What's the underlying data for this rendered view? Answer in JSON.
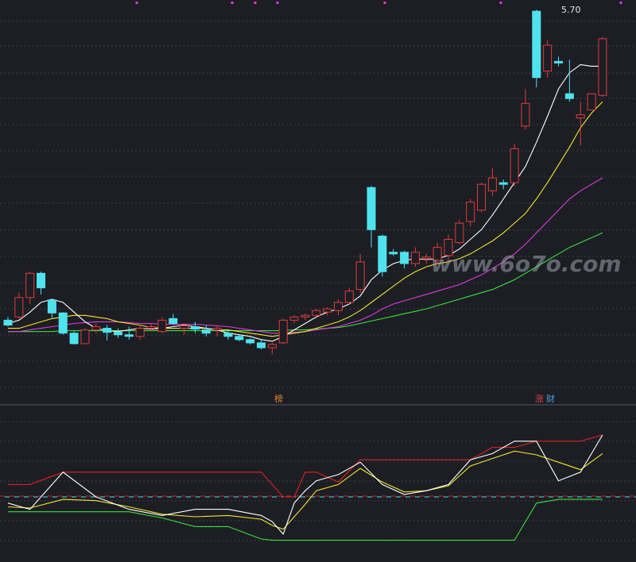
{
  "chart_data": {
    "type": "candlestick",
    "peak_label": "5.70",
    "watermark": "www.6o7o.com",
    "tags": [
      {
        "text": "榜",
        "color": "#e08a2e"
      },
      {
        "text": "涨",
        "color": "#e04040"
      },
      {
        "text": "财",
        "color": "#4aa0e0"
      }
    ],
    "colors": {
      "up": "#e03b3b",
      "down": "#4fe3ee",
      "ma5": "#ffffff",
      "ma10": "#f2e62a",
      "ma20": "#e03be0",
      "ma60": "#3be03b",
      "ind_red": "#e02020",
      "ind_white": "#ffffff",
      "ind_yellow": "#f2e62a",
      "ind_green": "#3be03b"
    },
    "price_range": [
      1.05,
      5.8
    ],
    "candles": [
      [
        1.9,
        1.94,
        1.82,
        1.84
      ],
      [
        1.94,
        2.24,
        1.92,
        2.18
      ],
      [
        2.18,
        2.5,
        2.1,
        2.48
      ],
      [
        2.48,
        2.5,
        2.22,
        2.3
      ],
      [
        2.15,
        2.16,
        1.93,
        1.99
      ],
      [
        1.99,
        2.0,
        1.72,
        1.74
      ],
      [
        1.74,
        1.76,
        1.6,
        1.61
      ],
      [
        1.61,
        1.8,
        1.6,
        1.78
      ],
      [
        1.78,
        1.86,
        1.74,
        1.82
      ],
      [
        1.8,
        1.84,
        1.65,
        1.75
      ],
      [
        1.75,
        1.8,
        1.68,
        1.72
      ],
      [
        1.72,
        1.82,
        1.66,
        1.7
      ],
      [
        1.7,
        1.84,
        1.66,
        1.8
      ],
      [
        1.8,
        1.86,
        1.76,
        1.82
      ],
      [
        1.76,
        1.94,
        1.74,
        1.9
      ],
      [
        1.92,
        1.98,
        1.84,
        1.86
      ],
      [
        1.8,
        1.86,
        1.72,
        1.83
      ],
      [
        1.82,
        1.88,
        1.74,
        1.79
      ],
      [
        1.78,
        1.84,
        1.7,
        1.74
      ],
      [
        1.78,
        1.84,
        1.7,
        1.8
      ],
      [
        1.74,
        1.78,
        1.66,
        1.7
      ],
      [
        1.7,
        1.72,
        1.64,
        1.66
      ],
      [
        1.66,
        1.68,
        1.6,
        1.62
      ],
      [
        1.62,
        1.66,
        1.54,
        1.56
      ],
      [
        1.56,
        1.62,
        1.48,
        1.6
      ],
      [
        1.62,
        1.92,
        1.6,
        1.9
      ],
      [
        1.9,
        1.96,
        1.86,
        1.94
      ],
      [
        1.94,
        1.98,
        1.9,
        1.96
      ],
      [
        1.96,
        2.04,
        1.92,
        2.02
      ],
      [
        2.0,
        2.06,
        1.96,
        2.04
      ],
      [
        2.02,
        2.16,
        1.96,
        2.12
      ],
      [
        2.12,
        2.3,
        2.1,
        2.26
      ],
      [
        2.28,
        2.72,
        2.24,
        2.62
      ],
      [
        3.54,
        3.56,
        2.8,
        3.02
      ],
      [
        2.94,
        2.96,
        2.44,
        2.5
      ],
      [
        2.74,
        2.78,
        2.7,
        2.72
      ],
      [
        2.74,
        2.76,
        2.54,
        2.6
      ],
      [
        2.6,
        2.8,
        2.56,
        2.74
      ],
      [
        2.66,
        2.72,
        2.6,
        2.68
      ],
      [
        2.64,
        2.86,
        2.6,
        2.8
      ],
      [
        2.7,
        2.96,
        2.66,
        2.9
      ],
      [
        2.86,
        3.14,
        2.84,
        3.1
      ],
      [
        3.12,
        3.4,
        3.06,
        3.36
      ],
      [
        3.26,
        3.6,
        3.24,
        3.58
      ],
      [
        3.5,
        3.78,
        3.44,
        3.66
      ],
      [
        3.6,
        3.64,
        3.52,
        3.58
      ],
      [
        3.6,
        4.08,
        3.56,
        4.02
      ],
      [
        4.3,
        4.76,
        4.26,
        4.58
      ],
      [
        5.72,
        5.74,
        4.78,
        4.9
      ],
      [
        4.98,
        5.36,
        4.9,
        5.3
      ],
      [
        5.1,
        5.16,
        5.04,
        5.08
      ],
      [
        4.7,
        5.12,
        4.6,
        4.64
      ],
      [
        4.4,
        4.6,
        4.06,
        4.44
      ],
      [
        4.5,
        4.7,
        4.5,
        4.7
      ],
      [
        4.68,
        5.4,
        4.66,
        5.38
      ]
    ],
    "ma5": [
      1.86,
      1.9,
      2.0,
      2.12,
      2.16,
      2.12,
      2.0,
      1.88,
      1.8,
      1.77,
      1.76,
      1.78,
      1.8,
      1.79,
      1.8,
      1.82,
      1.84,
      1.82,
      1.8,
      1.78,
      1.74,
      1.72,
      1.7,
      1.66,
      1.64,
      1.7,
      1.78,
      1.86,
      1.94,
      2.0,
      2.04,
      2.1,
      2.2,
      2.4,
      2.52,
      2.6,
      2.64,
      2.66,
      2.65,
      2.66,
      2.7,
      2.78,
      2.9,
      3.02,
      3.2,
      3.4,
      3.6,
      3.8,
      4.1,
      4.42,
      4.76,
      4.96,
      5.06,
      5.04,
      5.04
    ],
    "ma10": [
      1.8,
      1.8,
      1.84,
      1.88,
      1.92,
      1.94,
      1.96,
      1.96,
      1.94,
      1.92,
      1.88,
      1.86,
      1.84,
      1.81,
      1.8,
      1.8,
      1.8,
      1.8,
      1.8,
      1.78,
      1.78,
      1.76,
      1.74,
      1.72,
      1.7,
      1.72,
      1.74,
      1.76,
      1.8,
      1.84,
      1.88,
      1.94,
      2.02,
      2.12,
      2.22,
      2.32,
      2.42,
      2.5,
      2.56,
      2.6,
      2.62,
      2.66,
      2.72,
      2.8,
      2.88,
      2.98,
      3.1,
      3.22,
      3.4,
      3.6,
      3.82,
      4.04,
      4.28,
      4.46,
      4.6
    ],
    "ma20": [
      1.76,
      1.76,
      1.78,
      1.8,
      1.82,
      1.84,
      1.86,
      1.87,
      1.88,
      1.88,
      1.88,
      1.87,
      1.86,
      1.86,
      1.85,
      1.85,
      1.85,
      1.85,
      1.84,
      1.83,
      1.82,
      1.8,
      1.78,
      1.76,
      1.74,
      1.74,
      1.75,
      1.76,
      1.78,
      1.8,
      1.82,
      1.86,
      1.9,
      1.96,
      2.04,
      2.1,
      2.14,
      2.18,
      2.22,
      2.26,
      2.3,
      2.34,
      2.4,
      2.46,
      2.54,
      2.62,
      2.72,
      2.84,
      2.98,
      3.12,
      3.26,
      3.4,
      3.5,
      3.58,
      3.66
    ],
    "ma60": [
      1.76,
      1.76,
      1.76,
      1.76,
      1.76,
      1.77,
      1.77,
      1.77,
      1.77,
      1.77,
      1.77,
      1.77,
      1.77,
      1.77,
      1.77,
      1.77,
      1.77,
      1.77,
      1.77,
      1.77,
      1.77,
      1.77,
      1.77,
      1.77,
      1.77,
      1.77,
      1.78,
      1.78,
      1.79,
      1.8,
      1.81,
      1.83,
      1.86,
      1.89,
      1.92,
      1.95,
      1.98,
      2.01,
      2.04,
      2.08,
      2.12,
      2.16,
      2.2,
      2.24,
      2.28,
      2.34,
      2.4,
      2.48,
      2.56,
      2.64,
      2.72,
      2.8,
      2.86,
      2.92,
      2.98
    ],
    "indicator": {
      "range": [
        0,
        100
      ],
      "x": [
        0,
        2,
        5,
        8,
        11,
        14,
        17,
        20,
        23,
        24,
        25,
        26,
        27,
        28,
        30,
        32,
        34,
        36,
        38,
        40,
        42,
        44,
        46,
        48,
        50,
        52,
        54
      ],
      "red": [
        60,
        60,
        70,
        70,
        70,
        70,
        70,
        70,
        70,
        60,
        50,
        50,
        70,
        70,
        62,
        80,
        80,
        80,
        80,
        80,
        80,
        90,
        90,
        95,
        95,
        95,
        100
      ],
      "white": [
        45,
        40,
        70,
        50,
        40,
        35,
        40,
        40,
        35,
        30,
        20,
        45,
        55,
        63,
        68,
        78,
        60,
        52,
        55,
        60,
        80,
        85,
        95,
        95,
        63,
        70,
        100
      ],
      "yellow": [
        42,
        41,
        48,
        47,
        42,
        36,
        34,
        35,
        32,
        27,
        24,
        34,
        44,
        55,
        60,
        73,
        62,
        54,
        55,
        59,
        75,
        81,
        87,
        84,
        78,
        72,
        85
      ],
      "green": [
        38,
        38,
        38,
        38,
        38,
        33,
        26,
        26,
        16,
        15,
        15,
        15,
        15,
        15,
        15,
        15,
        15,
        15,
        15,
        15,
        15,
        15,
        15,
        45,
        48,
        48,
        48
      ],
      "cyan_dashed": 50,
      "red_dashed": 50
    }
  }
}
